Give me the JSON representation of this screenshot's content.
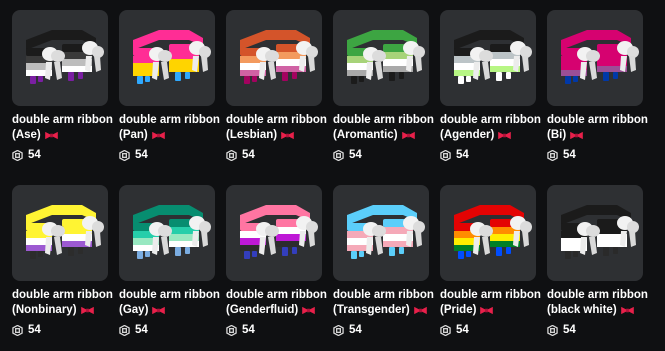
{
  "catalog": {
    "currency_icon": "robux-icon",
    "items": [
      {
        "name": "double arm ribbon",
        "variant": "(Ase)",
        "price": "54",
        "emoji": "ribbon-icon",
        "colors": [
          "#1b1b1b",
          "#3a3a3a",
          "#bdbdbd",
          "#ffffff",
          "#7a1fa2"
        ]
      },
      {
        "name": "double arm ribbon",
        "variant": "(Pan)",
        "price": "54",
        "emoji": "ribbon-icon",
        "colors": [
          "#ff2d95",
          "#ff2d95",
          "#ffd400",
          "#ffd400",
          "#2fa9ff"
        ]
      },
      {
        "name": "double arm ribbon",
        "variant": "(Lesbian)",
        "price": "54",
        "emoji": "ribbon-icon",
        "colors": [
          "#d4542a",
          "#f39a5e",
          "#ffffff",
          "#d062a4",
          "#a3025f"
        ]
      },
      {
        "name": "double arm ribbon",
        "variant": "(Aromantic)",
        "price": "54",
        "emoji": "ribbon-icon",
        "colors": [
          "#3da542",
          "#a7d379",
          "#ffffff",
          "#a9a9a9",
          "#1b1b1b"
        ]
      },
      {
        "name": "double arm ribbon",
        "variant": "(Agender)",
        "price": "54",
        "emoji": "ribbon-icon",
        "colors": [
          "#1b1b1b",
          "#bcc4c7",
          "#ffffff",
          "#b7f684",
          "#ffffff"
        ]
      },
      {
        "name": "double arm ribbon",
        "variant": "(Bi)",
        "price": "54",
        "emoji": "ribbon-icon",
        "colors": [
          "#d60270",
          "#d60270",
          "#d60270",
          "#9b4f96",
          "#0038a8"
        ]
      },
      {
        "name": "double arm ribbon",
        "variant": "(Nonbinary)",
        "price": "54",
        "emoji": "ribbon-icon",
        "colors": [
          "#fff433",
          "#fff433",
          "#ffffff",
          "#9c59d1",
          "#2c2c2c"
        ]
      },
      {
        "name": "double arm ribbon",
        "variant": "(Gay)",
        "price": "54",
        "emoji": "ribbon-icon",
        "colors": [
          "#078d70",
          "#26ceaa",
          "#98e8c1",
          "#ffffff",
          "#7bade2"
        ]
      },
      {
        "name": "double arm ribbon",
        "variant": "(Genderfluid)",
        "price": "54",
        "emoji": "ribbon-icon",
        "colors": [
          "#ff75a2",
          "#ffffff",
          "#be18d6",
          "#2c2c2c",
          "#333ebd"
        ]
      },
      {
        "name": "double arm ribbon",
        "variant": "(Transgender)",
        "price": "54",
        "emoji": "ribbon-icon",
        "colors": [
          "#5bcefa",
          "#f5a9b8",
          "#ffffff",
          "#f5a9b8",
          "#5bcefa"
        ]
      },
      {
        "name": "double arm ribbon",
        "variant": "(Pride)",
        "price": "54",
        "emoji": "ribbon-icon",
        "colors": [
          "#e40303",
          "#ff8c00",
          "#ffed00",
          "#008026",
          "#004dff"
        ]
      },
      {
        "name": "double arm ribbon",
        "variant": "(black white)",
        "price": "54",
        "emoji": "ribbon-icon",
        "colors": [
          "#1b1b1b",
          "#1b1b1b",
          "#ffffff",
          "#ffffff",
          "#2a2a2a"
        ]
      }
    ]
  }
}
